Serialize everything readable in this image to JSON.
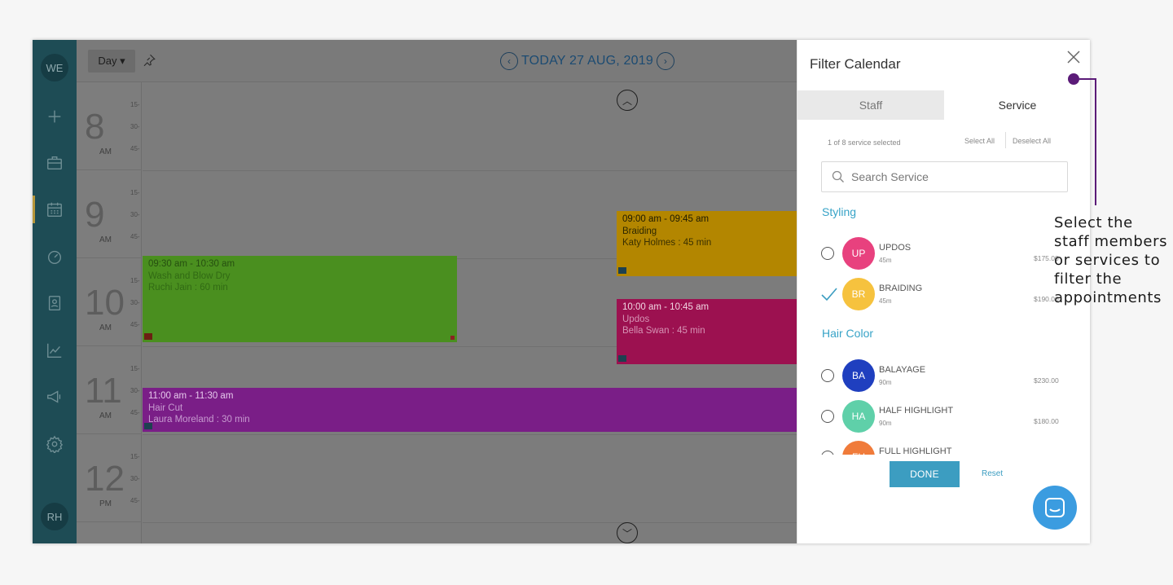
{
  "sidebar": {
    "top_avatar": "WE",
    "bottom_avatar": "RH",
    "icons": [
      "plus-icon",
      "briefcase-icon",
      "calendar-icon",
      "dashboard-icon",
      "contacts-icon",
      "chart-icon",
      "megaphone-icon",
      "gear-icon"
    ]
  },
  "calendar": {
    "view_label": "Day ▾",
    "date_label": "TODAY 27 AUG, 2019",
    "hours": [
      {
        "num": "8",
        "ampm": "AM"
      },
      {
        "num": "9",
        "ampm": "AM"
      },
      {
        "num": "10",
        "ampm": "AM"
      },
      {
        "num": "11",
        "ampm": "AM"
      },
      {
        "num": "12",
        "ampm": "PM"
      }
    ],
    "quarter_marks": [
      "15-",
      "30-",
      "45-"
    ],
    "appointments": [
      {
        "time": "09:00 am - 09:45 am",
        "service": "Braiding",
        "client": "Katy Holmes : 45 min",
        "color": "#b38600"
      },
      {
        "time": "09:30 am - 10:30 am",
        "service": "Wash and Blow Dry",
        "client": "Ruchi Jain : 60 min",
        "color": "#4a8f1f"
      },
      {
        "time": "10:00 am - 10:45 am",
        "service": "Updos",
        "client": "Bella Swan : 45 min",
        "color": "#9c1150"
      },
      {
        "time": "11:00 am - 11:30 am",
        "service": "Hair Cut",
        "client": "Laura Moreland : 30 min",
        "color": "#7a1e87"
      }
    ]
  },
  "filter": {
    "title": "Filter Calendar",
    "tabs": {
      "staff": "Staff",
      "service": "Service"
    },
    "selected_count": "1 of 8 service selected",
    "select_all": "Select All",
    "deselect_all": "Deselect All",
    "search_placeholder": "Search Service",
    "categories": {
      "styling": "Styling",
      "hair_color": "Hair Color"
    },
    "services": [
      {
        "initials": "UP",
        "name": "UPDOS",
        "duration": "45m",
        "price": "$175.00",
        "color": "#e8417e",
        "selected": false
      },
      {
        "initials": "BR",
        "name": "BRAIDING",
        "duration": "45m",
        "price": "$190.00",
        "color": "#f6c23e",
        "selected": true
      },
      {
        "initials": "BA",
        "name": "BALAYAGE",
        "duration": "90m",
        "price": "$230.00",
        "color": "#1f3fbf",
        "selected": false
      },
      {
        "initials": "HA",
        "name": "HALF HIGHLIGHT",
        "duration": "90m",
        "price": "$180.00",
        "color": "#5fd0a9",
        "selected": false
      },
      {
        "initials": "FH",
        "name": "FULL HIGHLIGHT",
        "duration": "",
        "price": "",
        "color": "#f07b3a",
        "selected": false
      }
    ],
    "done_label": "DONE",
    "reset_label": "Reset"
  },
  "annotation": {
    "text": "Select the staff members or services to filter the appointments",
    "color": "#5b1b78"
  }
}
